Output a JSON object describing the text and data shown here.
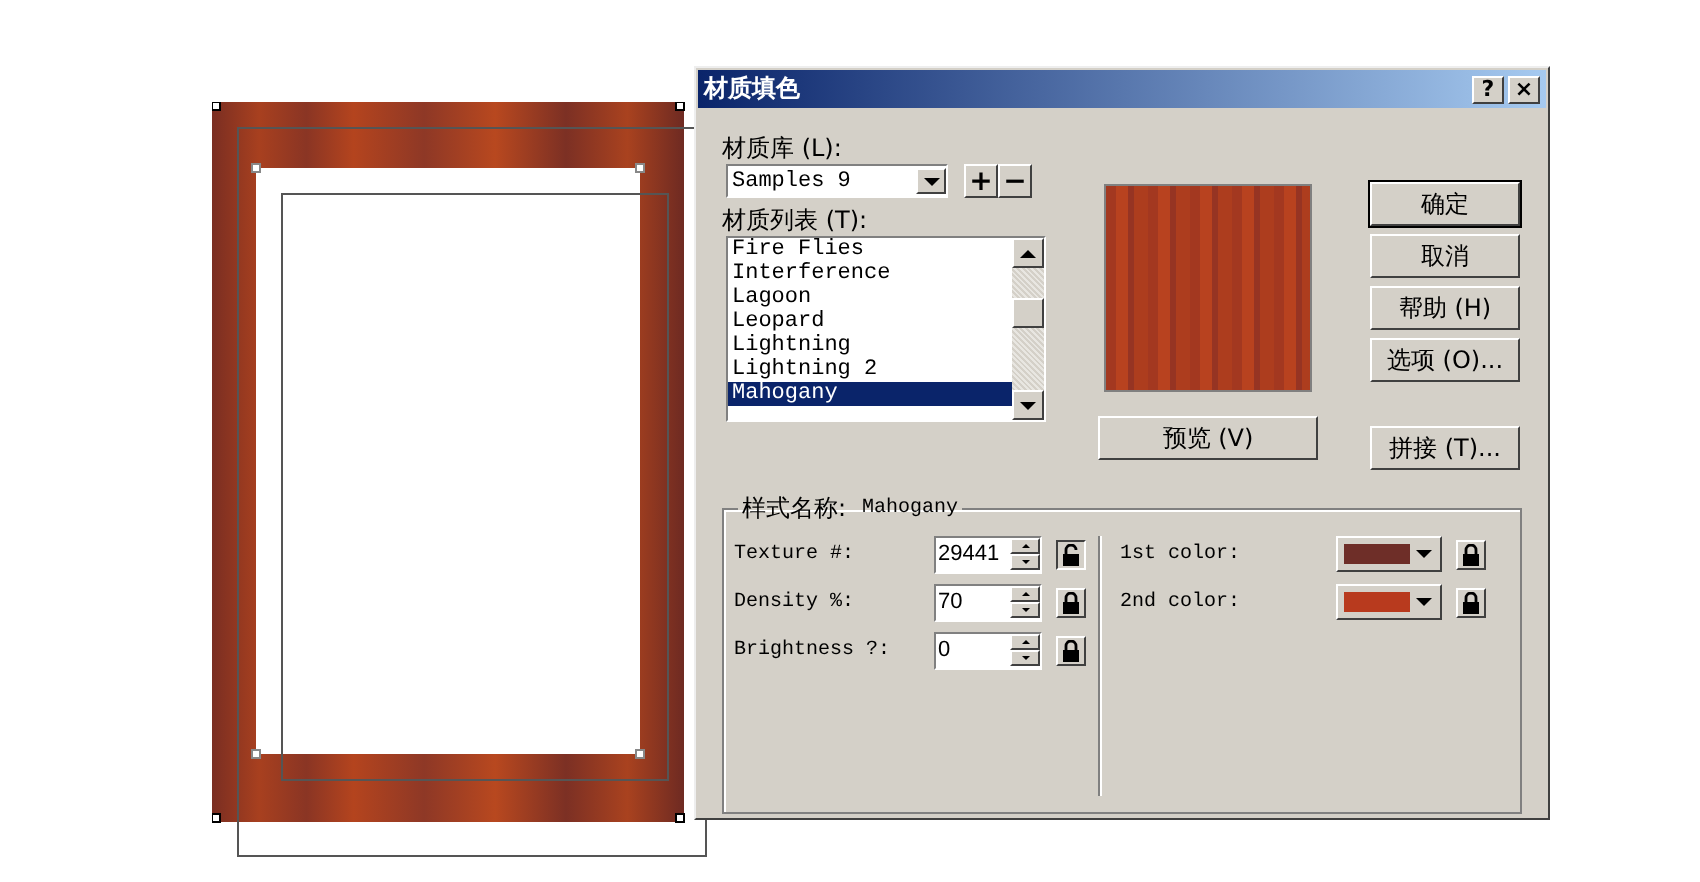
{
  "dialog": {
    "title": "材质填色",
    "help_button": "?",
    "close_button": "×"
  },
  "library": {
    "label": "材质库 (L):",
    "value": "Samples 9",
    "add_button": "+",
    "remove_button": "−"
  },
  "texture_list": {
    "label": "材质列表 (T):",
    "items": [
      {
        "name": "Fire Flies",
        "selected": false
      },
      {
        "name": "Interference",
        "selected": false
      },
      {
        "name": "Lagoon",
        "selected": false
      },
      {
        "name": "Leopard",
        "selected": false
      },
      {
        "name": "Lightning",
        "selected": false
      },
      {
        "name": "Lightning 2",
        "selected": false
      },
      {
        "name": "Mahogany",
        "selected": true
      }
    ]
  },
  "preview_button": "预览 (V)",
  "buttons": [
    {
      "label": "确定",
      "default": true
    },
    {
      "label": "取消",
      "default": false
    },
    {
      "label": "帮助 (H)",
      "default": false
    },
    {
      "label": "选项 (O)...",
      "default": false
    }
  ],
  "tile_button": "拼接 (T)...",
  "style_group": {
    "label": "样式名称:",
    "name": "Mahogany",
    "params": [
      {
        "label": "Texture #:",
        "value": "29441",
        "locked": false
      },
      {
        "label": "Density %:",
        "value": "70",
        "locked": true
      },
      {
        "label": "Brightness ?:",
        "value": "0",
        "locked": true
      }
    ],
    "colors": [
      {
        "label": "1st color:",
        "color": "#6e2e28",
        "locked": true
      },
      {
        "label": "2nd color:",
        "color": "#b83a1e",
        "locked": true
      }
    ]
  }
}
